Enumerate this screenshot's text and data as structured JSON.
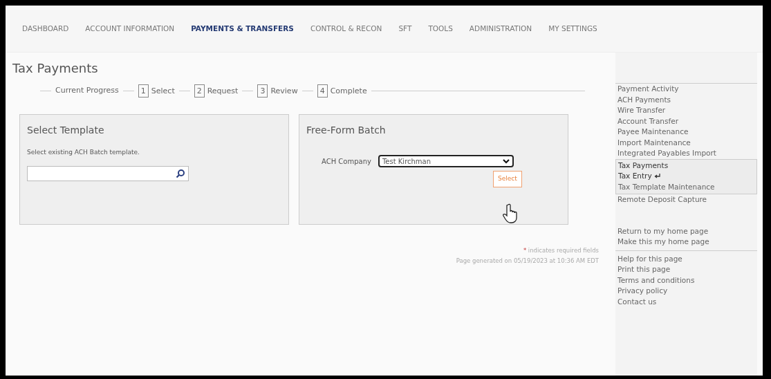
{
  "nav": [
    {
      "label": "DASHBOARD",
      "selected": false
    },
    {
      "label": "ACCOUNT INFORMATION",
      "selected": false
    },
    {
      "label": "PAYMENTS & TRANSFERS",
      "selected": true
    },
    {
      "label": "CONTROL & RECON",
      "selected": false
    },
    {
      "label": "SFT",
      "selected": false
    },
    {
      "label": "TOOLS",
      "selected": false
    },
    {
      "label": "ADMINISTRATION",
      "selected": false
    },
    {
      "label": "MY SETTINGS",
      "selected": false
    }
  ],
  "page_title": "Tax Payments",
  "progress": {
    "label": "Current Progress",
    "steps": [
      {
        "number": "1",
        "label": "Select"
      },
      {
        "number": "2",
        "label": "Request"
      },
      {
        "number": "3",
        "label": "Review"
      },
      {
        "number": "4",
        "label": "Complete"
      }
    ]
  },
  "select_template": {
    "title": "Select Template",
    "instruction": "Select existing ACH Batch template."
  },
  "free_form": {
    "title": "Free-Form Batch",
    "company_label": "ACH Company",
    "company_value": "Test Kirchman",
    "button": "Select"
  },
  "required_note": {
    "mark": "*",
    "text": "indicates required fields"
  },
  "generated": "Page generated on 05/19/2023 at 10:36 AM EDT",
  "sidebar": {
    "menu": [
      {
        "label": "Payment Activity",
        "selected": false
      },
      {
        "label": "ACH Payments",
        "selected": false
      },
      {
        "label": "Wire Transfer",
        "selected": false
      },
      {
        "label": "Account Transfer",
        "selected": false
      },
      {
        "label": "Payee Maintenance",
        "selected": false
      },
      {
        "label": "Import Maintenance",
        "selected": false
      },
      {
        "label": "Integrated Payables Import",
        "selected": false
      },
      {
        "label": "Tax Payments",
        "selected": true,
        "children": [
          {
            "label": "Tax Entry",
            "selected": true
          },
          {
            "label": "Tax Template Maintenance",
            "selected": false
          }
        ]
      },
      {
        "label": "Remote Deposit Capture",
        "selected": false
      }
    ],
    "home_links": [
      "Return to my home page",
      "Make this my home page"
    ],
    "help_links": [
      "Help for this page",
      "Print this page",
      "Terms and conditions",
      "Privacy policy",
      "Contact us"
    ]
  }
}
